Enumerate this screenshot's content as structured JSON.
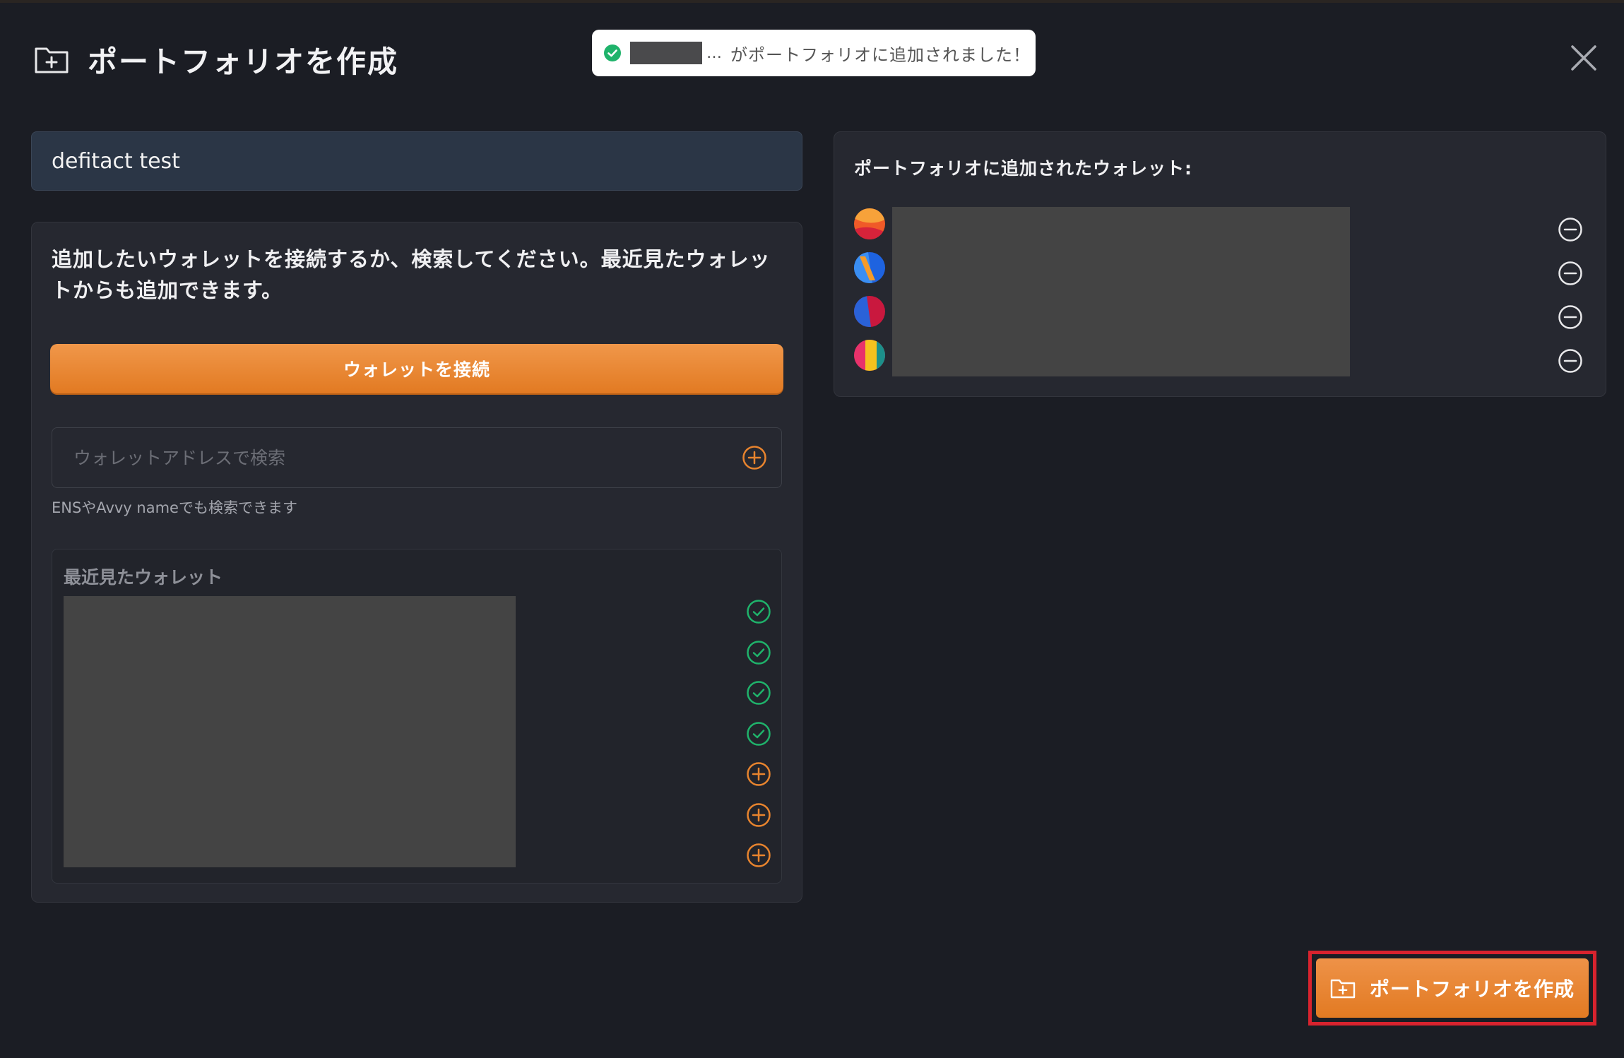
{
  "modal": {
    "title": "ポートフォリオを作成",
    "title_icon": "folder-plus-icon",
    "close_icon": "close-icon"
  },
  "toast": {
    "ellipsis": "…",
    "message": "がポートフォリオに追加されました！",
    "icon": "check-circle-icon",
    "color": "#1fb36b"
  },
  "portfolio_name": {
    "value": "defitact test"
  },
  "left": {
    "instructions": "追加したいウォレットを接続するか、検索してください。最近見たウォレットからも追加できます。",
    "connect_button": "ウォレットを接続",
    "search": {
      "placeholder": "ウォレットアドレスで検索",
      "hint": "ENSやAvvy nameでも検索できます",
      "add_icon": "plus-circle-icon"
    },
    "recent": {
      "title": "最近見たウォレット",
      "items": [
        {
          "status": "added",
          "icon": "check-circle-icon"
        },
        {
          "status": "added",
          "icon": "check-circle-icon"
        },
        {
          "status": "added",
          "icon": "check-circle-icon"
        },
        {
          "status": "added",
          "icon": "check-circle-icon"
        },
        {
          "status": "not-added",
          "icon": "plus-circle-icon"
        },
        {
          "status": "not-added",
          "icon": "plus-circle-icon"
        },
        {
          "status": "not-added",
          "icon": "plus-circle-icon"
        }
      ]
    }
  },
  "right": {
    "title": "ポートフォリオに追加されたウォレット:",
    "wallets": [
      {
        "avatar": "wallet-avatar-1",
        "remove_icon": "minus-circle-icon"
      },
      {
        "avatar": "wallet-avatar-2",
        "remove_icon": "minus-circle-icon"
      },
      {
        "avatar": "wallet-avatar-3",
        "remove_icon": "minus-circle-icon"
      },
      {
        "avatar": "wallet-avatar-4",
        "remove_icon": "minus-circle-icon"
      }
    ]
  },
  "footer": {
    "create_button": "ポートフォリオを作成",
    "create_icon": "folder-plus-icon"
  },
  "colors": {
    "background": "#1b1d24",
    "panel": "#262830",
    "accent_orange": "#e8842e",
    "success_green": "#1fb36b",
    "highlight_red": "#d8232e"
  }
}
